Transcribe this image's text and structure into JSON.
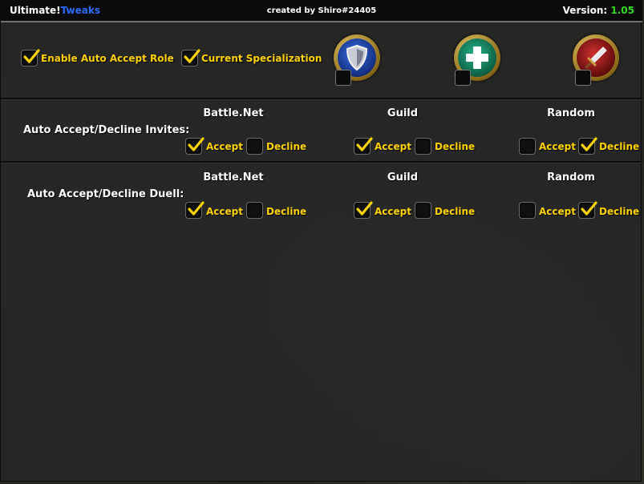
{
  "title": {
    "left_part1": "Ultimate!",
    "left_part2": "Tweaks",
    "center": "created by Shiro#24405",
    "version_label": "Version:",
    "version_value": "1.05"
  },
  "colors": {
    "check": "#ffd200",
    "label": "#ffd200",
    "title_accent": "#2a6cff",
    "version": "#33dd22"
  },
  "top_options": {
    "auto_accept_role": {
      "label": "Enable Auto Accept Role",
      "checked": true
    },
    "current_spec": {
      "label": "Current Specialization",
      "checked": true
    }
  },
  "roles": [
    {
      "name": "tank",
      "icon": "shield-icon",
      "checked": false
    },
    {
      "name": "healer",
      "icon": "plus-icon",
      "checked": false
    },
    {
      "name": "damage",
      "icon": "sword-icon",
      "checked": false
    }
  ],
  "columns": [
    "Battle.Net",
    "Guild",
    "Random"
  ],
  "invites": {
    "label": "Auto Accept/Decline Invites:",
    "accept_label": "Accept",
    "decline_label": "Decline",
    "battlenet": {
      "accept": true,
      "decline": false
    },
    "guild": {
      "accept": true,
      "decline": false
    },
    "random": {
      "accept": false,
      "decline": true
    }
  },
  "duels": {
    "label": "Auto Accept/Decline Duell:",
    "accept_label": "Accept",
    "decline_label": "Decline",
    "battlenet": {
      "accept": true,
      "decline": false
    },
    "guild": {
      "accept": true,
      "decline": false
    },
    "random": {
      "accept": false,
      "decline": true
    }
  }
}
